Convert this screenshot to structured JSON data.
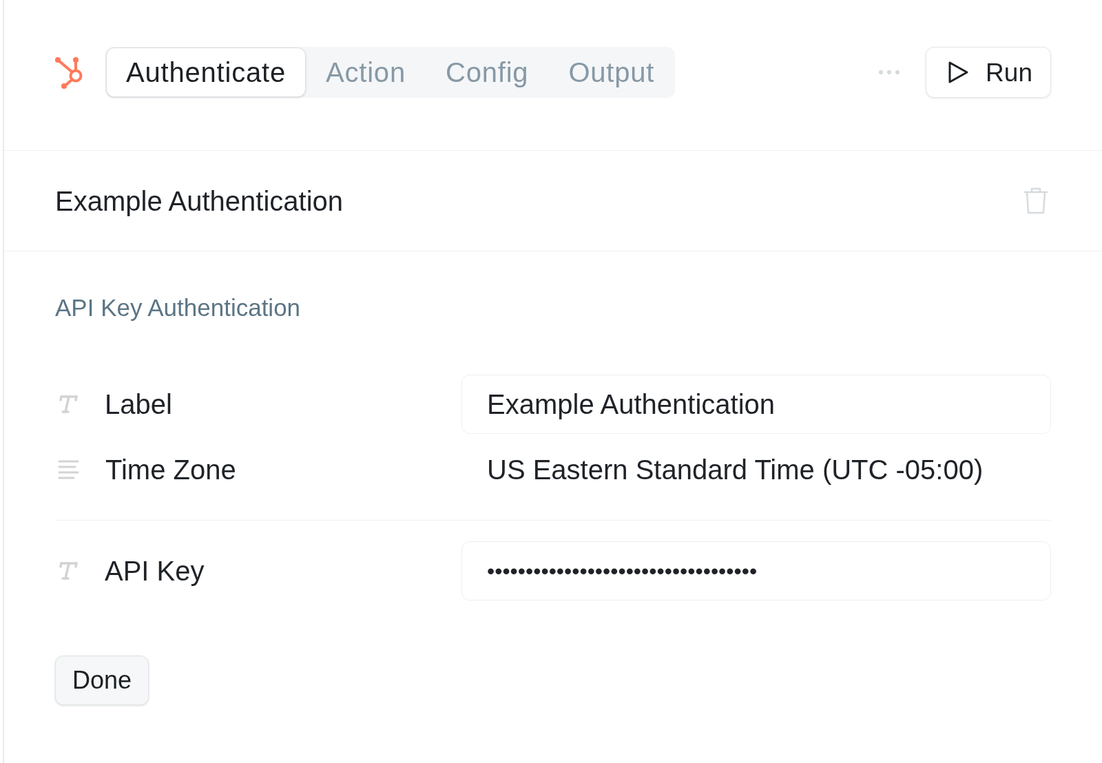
{
  "header": {
    "tabs": [
      {
        "label": "Authenticate",
        "selected": true
      },
      {
        "label": "Action",
        "selected": false
      },
      {
        "label": "Config",
        "selected": false
      },
      {
        "label": "Output",
        "selected": false
      }
    ],
    "run_button": {
      "label": "Run"
    }
  },
  "auth_title": "Example Authentication",
  "form": {
    "heading": "API Key Authentication",
    "groups": [
      {
        "fields": [
          {
            "kind": "text",
            "label": "Label",
            "value": "Example Authentication"
          },
          {
            "kind": "select",
            "label": "Time Zone",
            "value": "US Eastern Standard Time (UTC -05:00)"
          }
        ]
      },
      {
        "fields": [
          {
            "kind": "secret",
            "label": "API Key",
            "value": "•••••••••••••••••••••••••••••••••••"
          }
        ]
      }
    ]
  },
  "done_button": {
    "label": "Done"
  }
}
